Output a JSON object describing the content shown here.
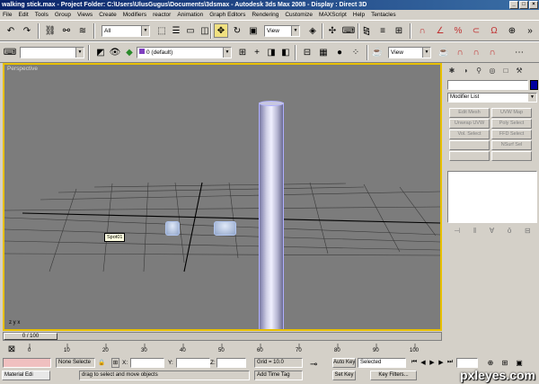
{
  "window": {
    "title": "walking stick.max - Project Folder: C:\\Users\\UlusGugus\\Documents\\3dsmax - Autodesk 3ds Max 2008 - Display : Direct 3D",
    "min": "_",
    "max": "□",
    "close": "×"
  },
  "menu": [
    "File",
    "Edit",
    "Tools",
    "Group",
    "Views",
    "Create",
    "Modifiers",
    "reactor",
    "Animation",
    "Graph Editors",
    "Rendering",
    "Customize",
    "MAXScript",
    "Help",
    "Tentacles"
  ],
  "toolbar": {
    "selection_filter": "All",
    "ref_coord": "View",
    "layer": "0 (default)",
    "view2": "View"
  },
  "viewport": {
    "label": "Perspective",
    "object_label": "Spot01",
    "axis": "z y x"
  },
  "command_panel": {
    "modifier_list": "Modifier List",
    "buttons": [
      "Edit Mesh",
      "UVW Map",
      "Unwrap UVW",
      "Poly Select",
      "Vol. Select",
      "FFD Select",
      "",
      "NSurf Sel",
      "",
      ""
    ]
  },
  "timeline": {
    "slider_label": "0 / 100",
    "ticks": [
      "0",
      "10",
      "20",
      "30",
      "40",
      "50",
      "60",
      "70",
      "80",
      "90",
      "100"
    ]
  },
  "status": {
    "selection": "None Selecte",
    "x_label": "X:",
    "y_label": "Y:",
    "z_label": "Z:",
    "grid": "Grid = 10.0",
    "auto_key": "Auto Key",
    "selected": "Selected",
    "set_key": "Set Key",
    "key_filters": "Key Filters...",
    "prompt": "drag to select and move objects",
    "add_time_tag": "Add Time Tag",
    "maxscript": "Material Edi"
  },
  "watermark": "pxleyes.com"
}
